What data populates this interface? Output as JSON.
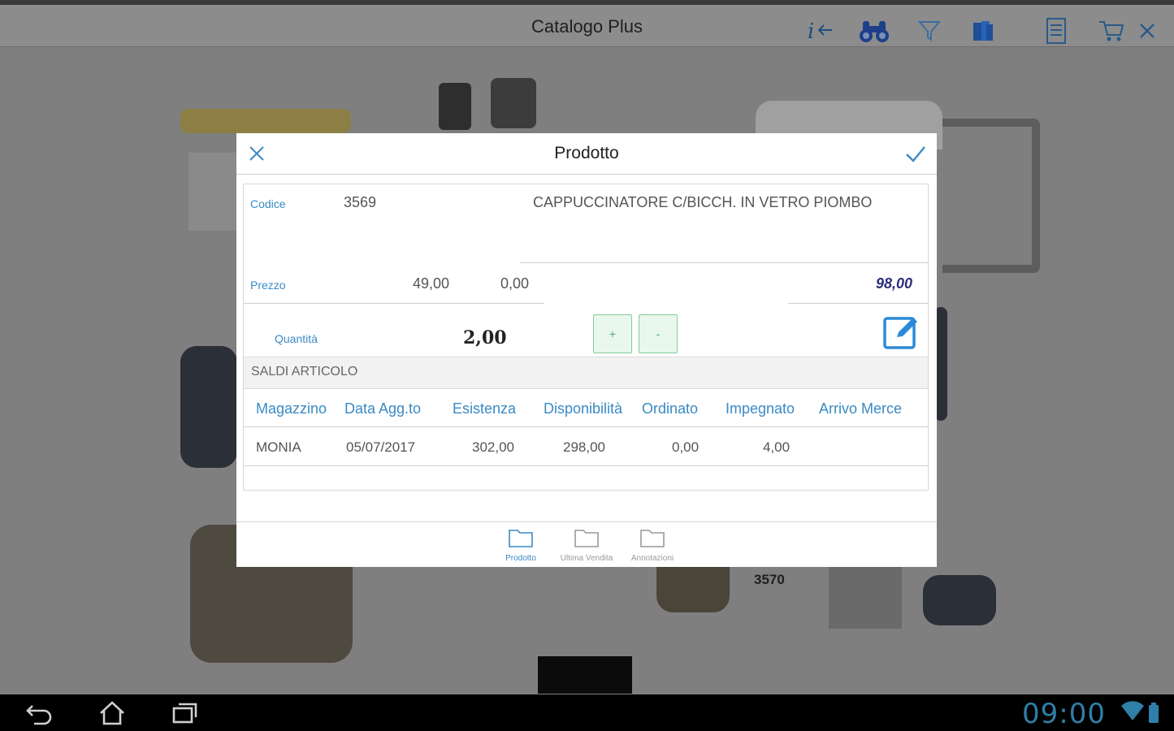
{
  "app": {
    "title": "Catalogo Plus"
  },
  "toolbar": {
    "icons": [
      "info-back-icon",
      "binoculars-icon",
      "filter-icon",
      "catalog-books-icon",
      "document-icon",
      "cart-icon",
      "close-icon"
    ]
  },
  "catalog": {
    "product_code_label": "3570"
  },
  "dialog": {
    "title": "Prodotto",
    "fields": {
      "codice_label": "Codice",
      "codice_value": "3569",
      "description": "CAPPUCCINATORE C/BICCH. IN VETRO PIOMBO",
      "prezzo_label": "Prezzo",
      "prezzo_value": "49,00",
      "sconto_value": "0,00",
      "totale_value": "98,00",
      "quantita_label": "Quantità",
      "quantita_value": "2,00",
      "plus_label": "+",
      "minus_label": "-"
    },
    "saldi": {
      "title": "SALDI ARTICOLO",
      "columns": [
        "Magazzino",
        "Data Agg.to",
        "Esistenza",
        "Disponibilità",
        "Ordinato",
        "Impegnato",
        "Arrivo Merce"
      ],
      "rows": [
        [
          "MONIA",
          "05/07/2017",
          "302,00",
          "298,00",
          "0,00",
          "4,00",
          ""
        ]
      ]
    },
    "tabs": [
      {
        "label": "Prodotto",
        "active": true
      },
      {
        "label": "Ultima Vendita",
        "active": false
      },
      {
        "label": "Annotazioni",
        "active": false
      }
    ]
  },
  "statusbar": {
    "time": "09:00"
  },
  "colors": {
    "accent": "#3a8ac4",
    "overlay": "#7f7f7f",
    "clock": "#2f7fa8"
  }
}
